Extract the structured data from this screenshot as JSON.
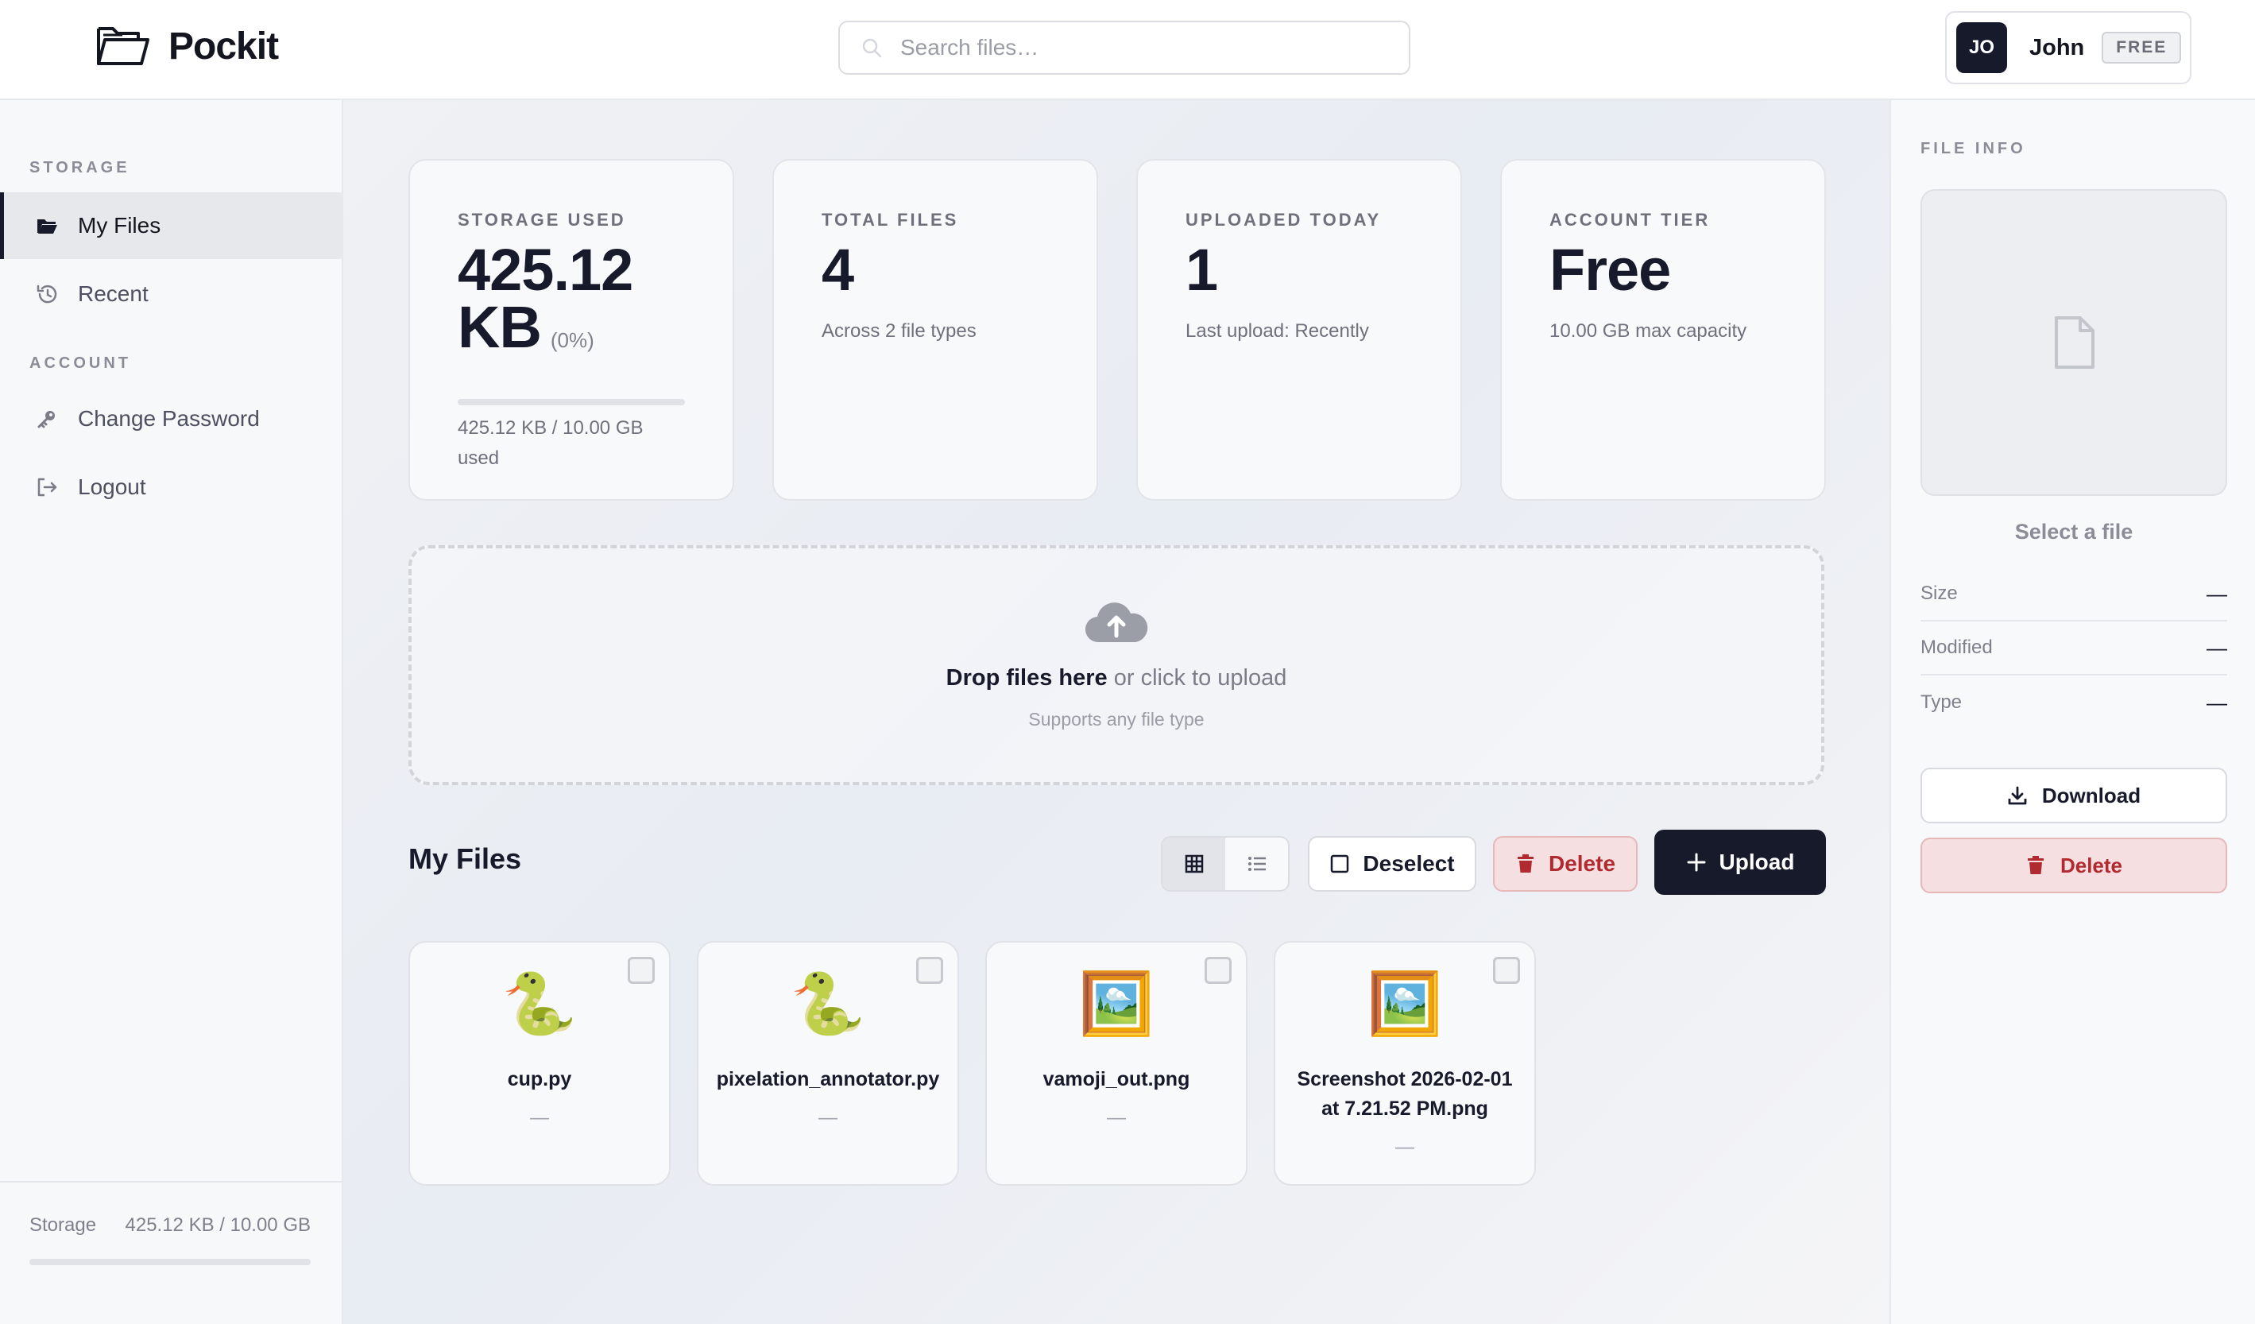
{
  "app": {
    "name": "Pockit"
  },
  "search": {
    "placeholder": "Search files…"
  },
  "user": {
    "initials": "JO",
    "name": "John",
    "tier_badge": "FREE"
  },
  "sidebar": {
    "storage_section": "STORAGE",
    "account_section": "ACCOUNT",
    "items": [
      {
        "label": "My Files",
        "icon": "folder-open-icon",
        "active": true
      },
      {
        "label": "Recent",
        "icon": "history-icon"
      },
      {
        "label": "Change Password",
        "icon": "key-icon"
      },
      {
        "label": "Logout",
        "icon": "logout-icon"
      }
    ],
    "footer": {
      "label": "Storage",
      "value": "425.12 KB / 10.00 GB",
      "usage_fraction": 0
    }
  },
  "stats": [
    {
      "label": "STORAGE USED",
      "value": "425.12 KB",
      "pct": "(0%)",
      "sub": "425.12 KB / 10.00 GB used",
      "usage_fraction": 0
    },
    {
      "label": "TOTAL FILES",
      "value": "4",
      "sub": "Across 2 file types"
    },
    {
      "label": "UPLOADED TODAY",
      "value": "1",
      "sub": "Last upload: Recently"
    },
    {
      "label": "ACCOUNT TIER",
      "value": "Free",
      "sub": "10.00 GB max capacity"
    }
  ],
  "dropzone": {
    "strong": "Drop files here",
    "rest": " or click to upload",
    "sub": "Supports any file type"
  },
  "files_section": {
    "title": "My Files",
    "view_mode": "grid",
    "deselect_label": "Deselect",
    "delete_label": "Delete",
    "upload_label": "Upload"
  },
  "files": [
    {
      "icon": "🐍",
      "name": "cup.py",
      "meta": "—"
    },
    {
      "icon": "🐍",
      "name": "pixelation_annotator.py",
      "meta": "—"
    },
    {
      "icon": "🖼️",
      "name": "vamoji_out.png",
      "meta": "—"
    },
    {
      "icon": "🖼️",
      "name": "Screenshot 2026-02-01 at 7.21.52 PM.png",
      "meta": "—"
    }
  ],
  "file_info": {
    "label": "FILE INFO",
    "placeholder": "Select a file",
    "rows": [
      {
        "key": "Size",
        "value": "—"
      },
      {
        "key": "Modified",
        "value": "—"
      },
      {
        "key": "Type",
        "value": "—"
      }
    ],
    "download_label": "Download",
    "delete_label": "Delete"
  },
  "colors": {
    "primary": "#161a2b",
    "danger": "#b02a30",
    "danger_bg": "#f6dfe0"
  }
}
